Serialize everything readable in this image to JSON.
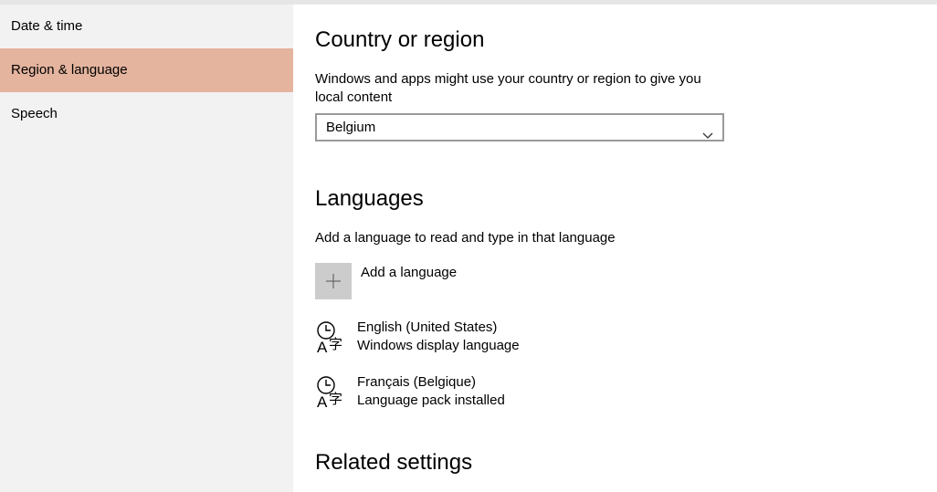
{
  "sidebar": {
    "items": [
      {
        "label": "Date & time"
      },
      {
        "label": "Region & language"
      },
      {
        "label": "Speech"
      }
    ]
  },
  "country": {
    "heading": "Country or region",
    "description_line1": "Windows and apps might use your country or region to give you",
    "description_line2": "local content",
    "selected": "Belgium"
  },
  "languages": {
    "heading": "Languages",
    "description": "Add a language to read and type in that language",
    "add_label": "Add a language",
    "items": [
      {
        "name": "English (United States)",
        "status": "Windows display language"
      },
      {
        "name": "Français (Belgique)",
        "status": "Language pack installed"
      }
    ]
  },
  "related": {
    "heading": "Related settings"
  },
  "colors": {
    "accent_selected": "#e4b49e",
    "sidebar_bg": "#f2f2f2",
    "add_button_bg": "#cccccc"
  },
  "icons": [
    "chevron-down-icon",
    "plus-icon",
    "language-icon"
  ]
}
